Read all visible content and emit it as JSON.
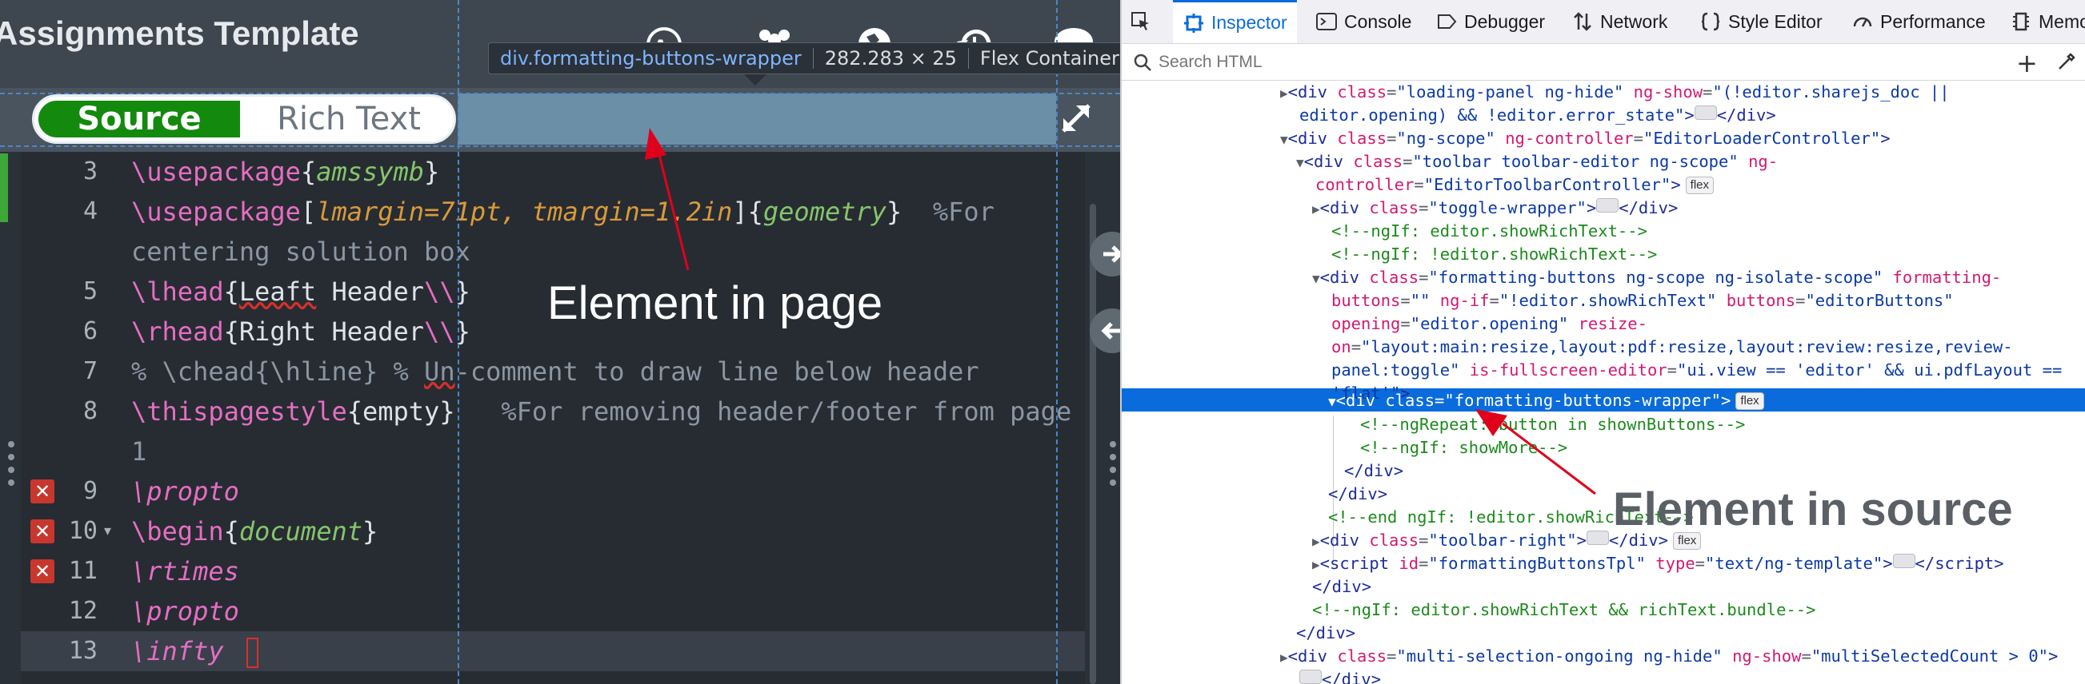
{
  "editor": {
    "doc_title": "Assignments Template",
    "tooltip": {
      "tag": "div",
      "class": ".formatting-buttons-wrapper",
      "dims": "282.283 × 25",
      "kind": "Flex Container"
    },
    "toggle": {
      "source": "Source",
      "rich_text": "Rich Text"
    },
    "toolbar_icons": [
      "review-icon",
      "share-icon",
      "history-icon",
      "chat-icon"
    ],
    "code_lines": [
      {
        "num": "3"
      },
      {
        "num": "4"
      },
      {
        "num": ""
      },
      {
        "num": "5"
      },
      {
        "num": "6"
      },
      {
        "num": "7"
      },
      {
        "num": "8"
      },
      {
        "num": ""
      },
      {
        "num": "9",
        "error": true
      },
      {
        "num": "10",
        "error": true,
        "fold": true
      },
      {
        "num": "11",
        "error": true
      },
      {
        "num": "12"
      },
      {
        "num": "13",
        "active": true
      }
    ],
    "annotation": "Element in page"
  },
  "devtools": {
    "tabs": [
      "Inspector",
      "Console",
      "Debugger",
      "Network",
      "Style Editor",
      "Performance",
      "Memo"
    ],
    "search_placeholder": "Search HTML",
    "flex_badge": "flex",
    "annotation": "Element in source"
  },
  "colors": {
    "source_toggle": "#138a0e",
    "highlight": "#6b8fa6",
    "selected_row": "#0a6cdc",
    "annotation_arrow": "#e0001b"
  }
}
